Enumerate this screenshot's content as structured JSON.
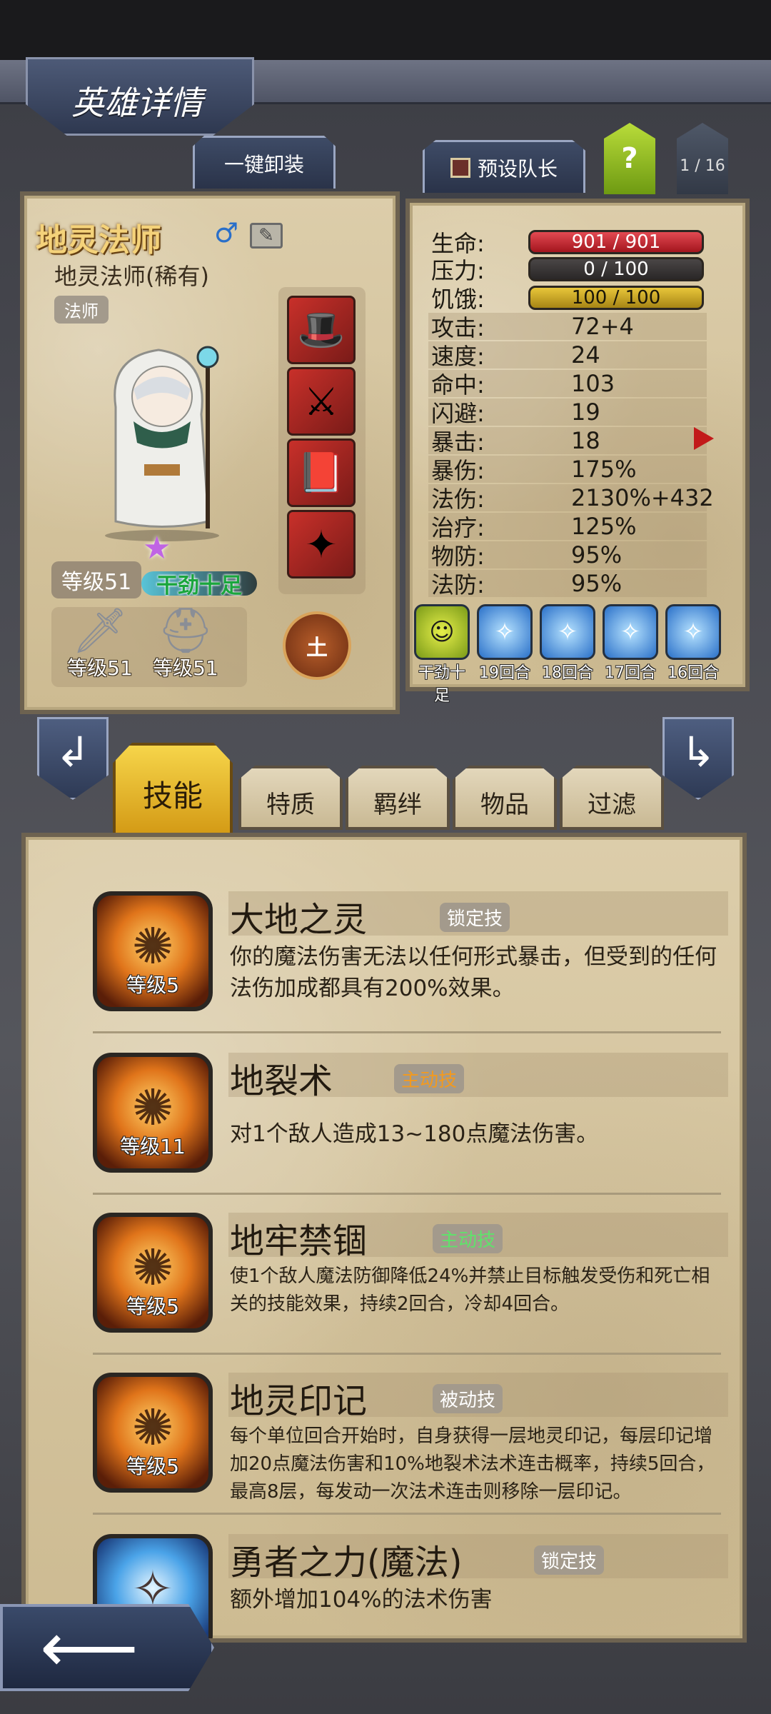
{
  "header": {
    "title": "英雄详情"
  },
  "top_buttons": {
    "unequip_all": "一键卸装",
    "preset_captain": "预设队长",
    "help": "?",
    "page_indicator": "1 / 16"
  },
  "hero": {
    "name": "地灵法师",
    "gender_icon": "male-symbol-icon",
    "subtitle": "地灵法师(稀有)",
    "class": "法师",
    "level": "等级51",
    "status": "干劲十足",
    "equipment": [
      {
        "name": "wizard-hat-icon",
        "glyph": "🎩"
      },
      {
        "name": "crossed-blades-icon",
        "glyph": "⚔"
      },
      {
        "name": "spellbook-icon",
        "glyph": "📕"
      },
      {
        "name": "staff-icon",
        "glyph": "✦"
      }
    ],
    "gear": [
      {
        "name": "weapon",
        "level": "等级51",
        "glyph": "🗡"
      },
      {
        "name": "helmet",
        "level": "等级51",
        "glyph": "⛑"
      }
    ],
    "element": "土"
  },
  "stats": {
    "hp": {
      "label": "生命:",
      "value": "901 / 901",
      "fraction": 1.0
    },
    "stress": {
      "label": "压力:",
      "value": "0 / 100",
      "fraction": 0.0
    },
    "hunger": {
      "label": "饥饿:",
      "value": "100 / 100",
      "fraction": 1.0
    },
    "rows": [
      {
        "label": "攻击:",
        "value": "72+4"
      },
      {
        "label": "速度:",
        "value": "24"
      },
      {
        "label": "命中:",
        "value": "103"
      },
      {
        "label": "闪避:",
        "value": "19"
      },
      {
        "label": "暴击:",
        "value": "18"
      },
      {
        "label": "暴伤:",
        "value": "175%"
      },
      {
        "label": "法伤:",
        "value": "2130%+432"
      },
      {
        "label": "治疗:",
        "value": "125%"
      },
      {
        "label": "物防:",
        "value": "95%"
      },
      {
        "label": "法防:",
        "value": "95%"
      }
    ]
  },
  "buffs": [
    {
      "label": "干劲十足",
      "icon": "smiley-face-icon"
    },
    {
      "label": "19回合",
      "icon": "blue-crystal-icon"
    },
    {
      "label": "18回合",
      "icon": "blue-crystal-icon"
    },
    {
      "label": "17回合",
      "icon": "blue-crystal-icon"
    },
    {
      "label": "16回合",
      "icon": "blue-crystal-icon"
    }
  ],
  "tabs": [
    "技能",
    "特质",
    "羁绊",
    "物品",
    "过滤"
  ],
  "active_tab": "技能",
  "skills": [
    {
      "name": "大地之灵",
      "tag": "锁定技",
      "tag_color": "#ffffff",
      "level": "等级5",
      "desc": "你的魔法伤害无法以任何形式暴击，但受到的任何法伤加成都具有200%效果。"
    },
    {
      "name": "地裂术",
      "tag": "主动技",
      "tag_color": "#f39a1e",
      "level": "等级11",
      "desc": "对1个敌人造成13~180点魔法伤害。"
    },
    {
      "name": "地牢禁锢",
      "tag": "主动技",
      "tag_color": "#5fe36b",
      "level": "等级5",
      "desc": "使1个敌人魔法防御降低24%并禁止目标触发受伤和死亡相关的技能效果，持续2回合，冷却4回合。"
    },
    {
      "name": "地灵印记",
      "tag": "被动技",
      "tag_color": "#ffffff",
      "level": "等级5",
      "desc": "每个单位回合开始时，自身获得一层地灵印记，每层印记增加20点魔法伤害和10%地裂术法术连击概率，持续5回合，最高8层，每发动一次法术连击则移除一层印记。"
    },
    {
      "name": "勇者之力(魔法)",
      "tag": "锁定技",
      "tag_color": "#ffffff",
      "level": "",
      "desc": "额外增加104%的法术伤害"
    }
  ]
}
